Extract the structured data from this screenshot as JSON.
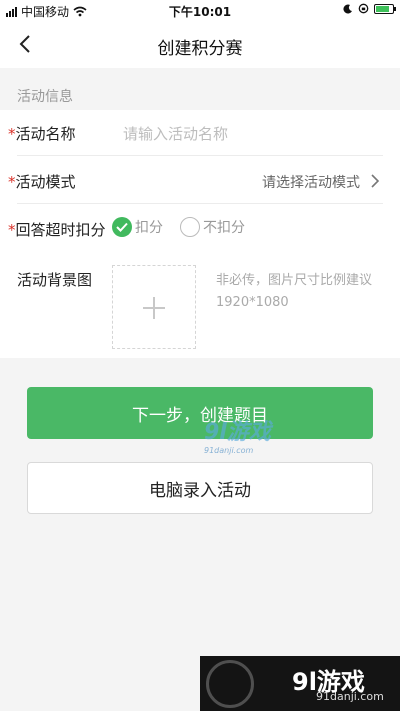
{
  "statusbar": {
    "carrier": "中国移动",
    "time": "下午10:01"
  },
  "nav": {
    "title": "创建积分赛"
  },
  "section": {
    "title": "活动信息"
  },
  "form": {
    "name": {
      "required": "*",
      "label": "活动名称",
      "placeholder": "请输入活动名称"
    },
    "mode": {
      "required": "*",
      "label": "活动模式",
      "value": "请选择活动模式"
    },
    "timeout": {
      "required": "*",
      "label": "回答超时扣分",
      "options": [
        {
          "label": "扣分",
          "selected": true
        },
        {
          "label": "不扣分",
          "selected": false
        }
      ]
    },
    "background": {
      "label": "活动背景图",
      "hint": "非必传，图片尺寸比例建议1920*1080"
    }
  },
  "buttons": {
    "next": "下一步，创建题目",
    "pc": "电脑录入活动"
  },
  "watermark": {
    "mid_text": "9l游戏",
    "mid_url": "91danji.com",
    "brand_name": "9l游戏",
    "brand_url": "91danji.com"
  },
  "colors": {
    "primary": "#4ab866",
    "required": "#d9332b",
    "background": "#f4f4f4"
  }
}
